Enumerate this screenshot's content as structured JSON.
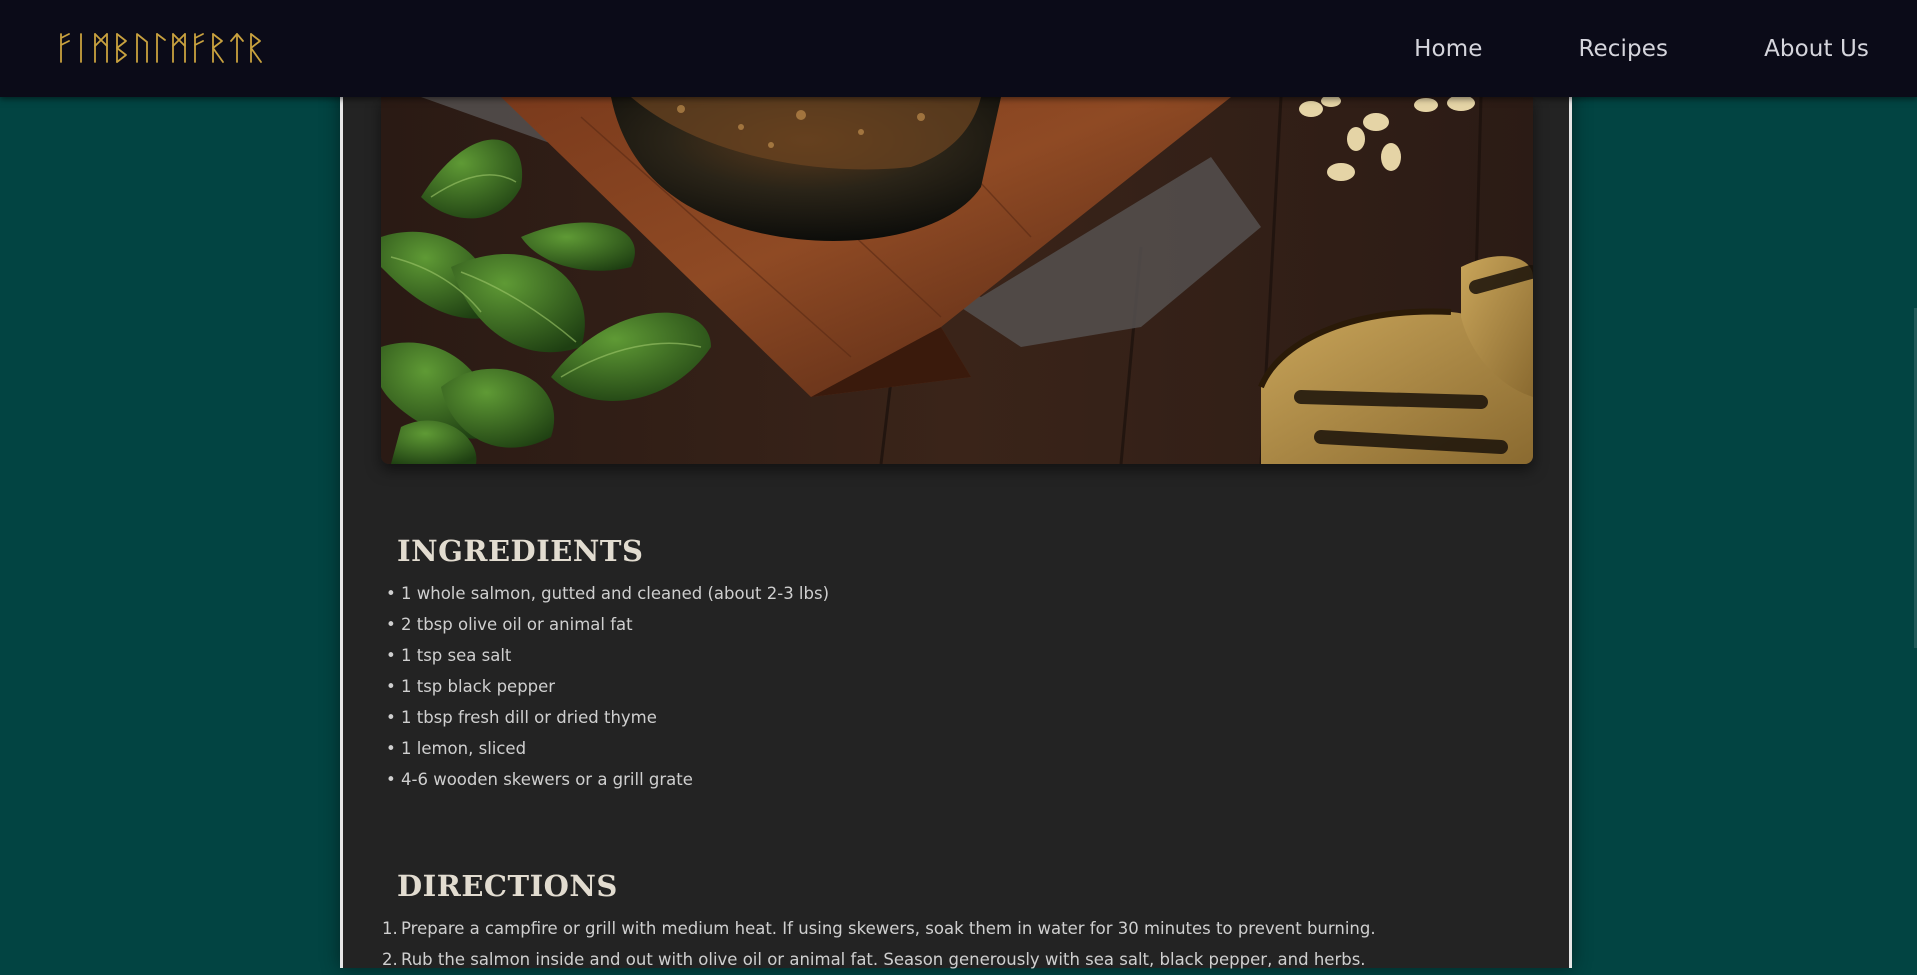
{
  "header": {
    "logo_text": "ᚠᛁᛗᛒᚢᛚᛗᚨᚱᛏᚱ",
    "nav": [
      "Home",
      "Recipes",
      "About Us"
    ]
  },
  "hero": {
    "alt": "Grilled salmon on a cedar plank with basil, pine nuts and grilled bread"
  },
  "ingredients": {
    "title": "INGREDIENTS",
    "items": [
      "1 whole salmon, gutted and cleaned (about 2-3 lbs)",
      "2 tbsp olive oil or animal fat",
      "1 tsp sea salt",
      "1 tsp black pepper",
      "1 tbsp fresh dill or dried thyme",
      "1 lemon, sliced",
      "4-6 wooden skewers or a grill grate"
    ]
  },
  "directions": {
    "title": "DIRECTIONS",
    "steps": [
      "Prepare a campfire or grill with medium heat. If using skewers, soak them in water for 30 minutes to prevent burning.",
      "Rub the salmon inside and out with olive oil or animal fat. Season generously with sea salt, black pepper, and herbs."
    ]
  },
  "colors": {
    "page_background": "#024442",
    "header_background": "#0b0b18",
    "logo_gold": "#c9a23f",
    "panel_background": "#232323",
    "panel_border": "#e6e6e6"
  }
}
